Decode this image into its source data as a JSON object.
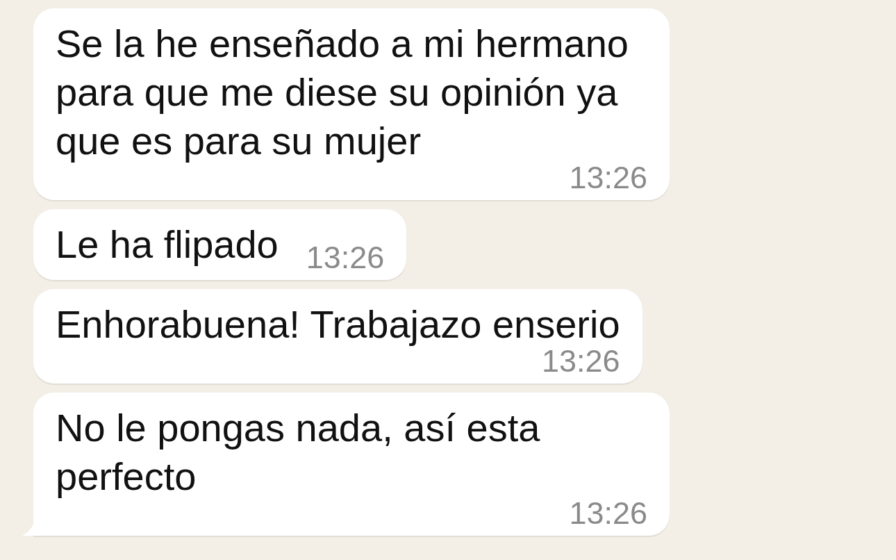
{
  "messages": [
    {
      "text": "Se la he enseñado a mi hermano para que me diese su opinión ya que es para su mujer",
      "time": "13:26",
      "tail": false
    },
    {
      "text": "Le ha flipado",
      "time": "13:26",
      "tail": false
    },
    {
      "text": "Enhorabuena! Trabajazo enserio",
      "time": "13:26",
      "tail": false
    },
    {
      "text": "No le pongas nada, así esta perfecto",
      "time": "13:26",
      "tail": true
    }
  ]
}
